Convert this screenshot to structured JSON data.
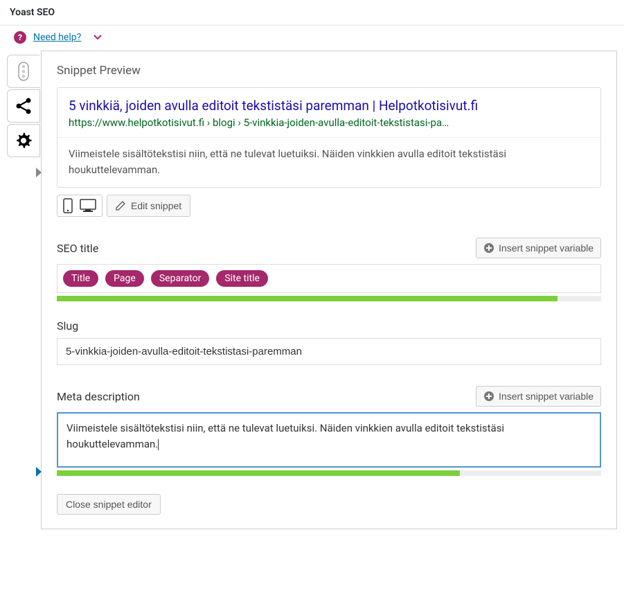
{
  "metabox": {
    "title": "Yoast SEO"
  },
  "help": {
    "label": "Need help?"
  },
  "snippet": {
    "heading": "Snippet Preview",
    "title": "5 vinkkiä, joiden avulla editoit tekstistäsi paremman | Helpotkotisivut.fi",
    "url": "https://www.helpotkotisivut.fi › blogi › 5-vinkkia-joiden-avulla-editoit-tekstistasi-pa…",
    "description": "Viimeistele sisältötekstisi niin, että ne tulevat luetuiksi. Näiden vinkkien avulla editoit tekstistäsi houkuttelevamman.",
    "edit_label": "Edit snippet"
  },
  "seo_title": {
    "label": "SEO title",
    "insert_label": "Insert snippet variable",
    "pills": [
      "Title",
      "Page",
      "Separator",
      "Site title"
    ],
    "progress_pct": 92
  },
  "slug": {
    "label": "Slug",
    "value": "5-vinkkia-joiden-avulla-editoit-tekstistasi-paremman"
  },
  "meta_desc": {
    "label": "Meta description",
    "insert_label": "Insert snippet variable",
    "value": "Viimeistele sisältötekstisi niin, että ne tulevat luetuiksi. Näiden vinkkien avulla editoit tekstistäsi houkuttelevamman.",
    "progress_pct": 74
  },
  "close_label": "Close snippet editor"
}
